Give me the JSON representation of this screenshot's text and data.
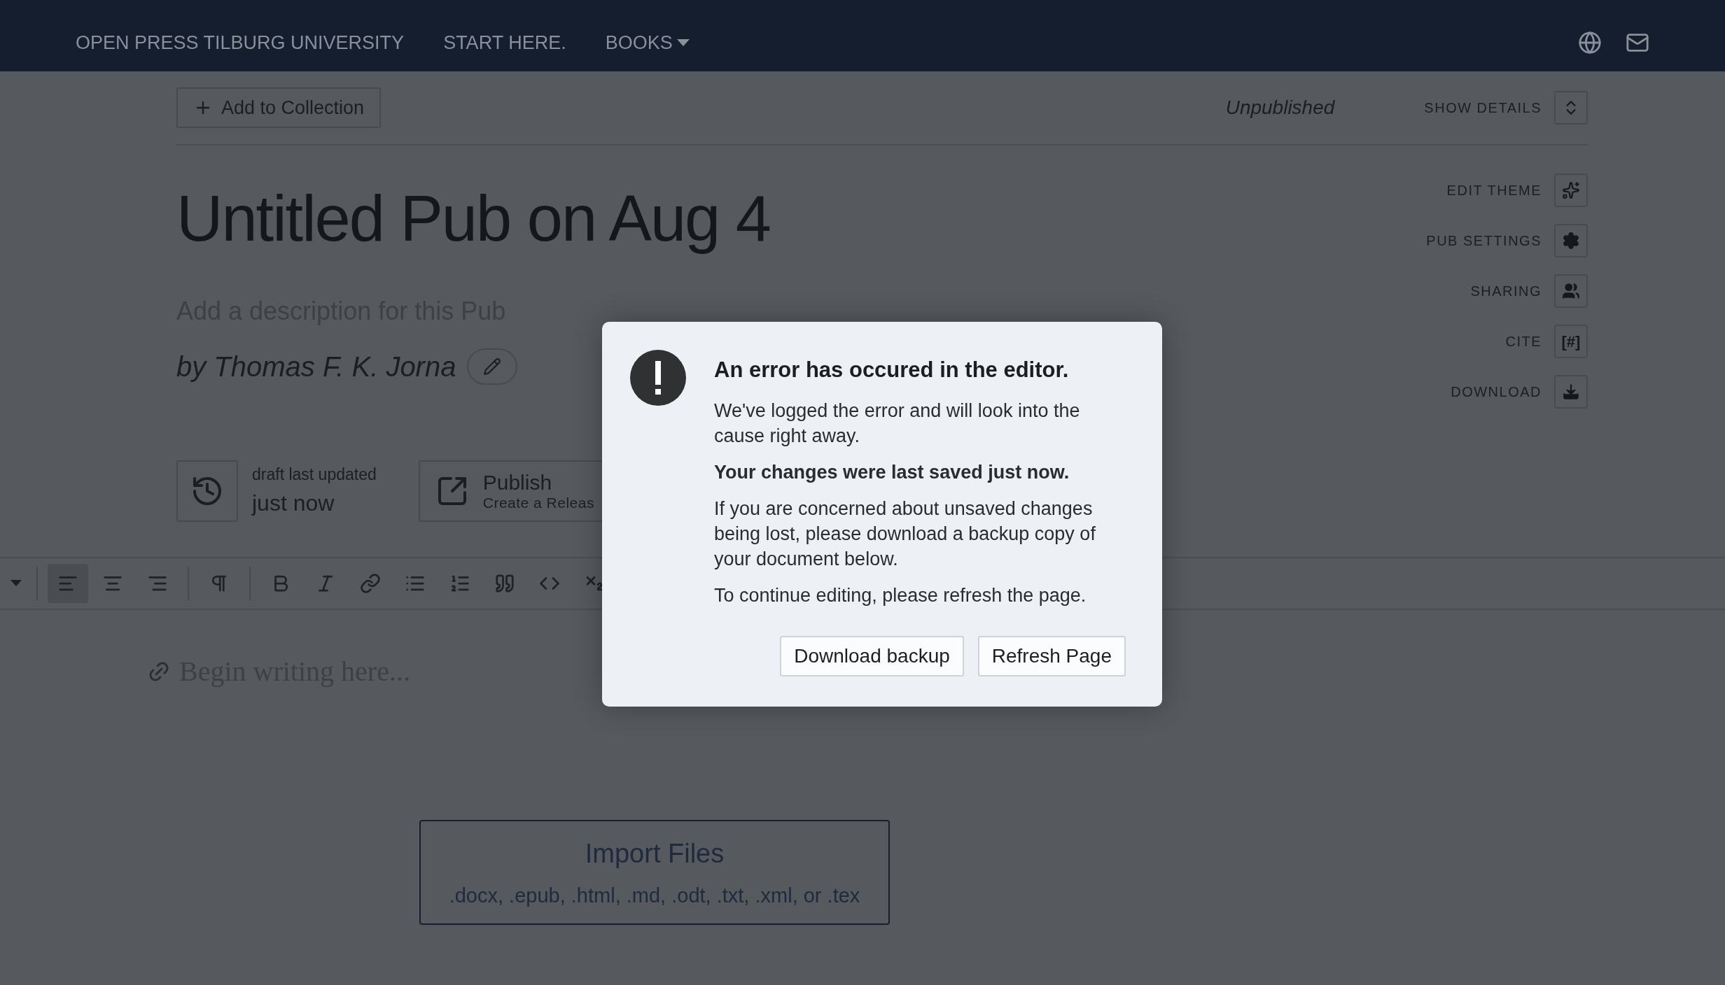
{
  "nav": {
    "items": [
      {
        "label": "OPEN PRESS TILBURG UNIVERSITY",
        "dropdown": false
      },
      {
        "label": "START HERE.",
        "dropdown": false
      },
      {
        "label": "BOOKS",
        "dropdown": true
      }
    ]
  },
  "header": {
    "collection_button": "Add to Collection",
    "status": "Unpublished",
    "details_button": "SHOW DETAILS"
  },
  "pub": {
    "title": "Untitled Pub on Aug 4",
    "description_placeholder": "Add a description for this Pub",
    "byline": "by Thomas F. K. Jorna"
  },
  "side_actions": [
    {
      "label": "EDIT THEME",
      "kind": "theme"
    },
    {
      "label": "PUB SETTINGS",
      "kind": "settings"
    },
    {
      "label": "SHARING",
      "kind": "sharing"
    },
    {
      "label": "CITE",
      "kind": "cite",
      "icon_text": "[#]"
    },
    {
      "label": "DOWNLOAD",
      "kind": "download"
    }
  ],
  "draft": {
    "caption": "draft last updated",
    "time": "just now"
  },
  "publish": {
    "title": "Publish",
    "subtitle": "Create a Releas"
  },
  "toolbar": [
    {
      "kind": "menu",
      "selected": false
    },
    {
      "kind": "align-left",
      "selected": true
    },
    {
      "kind": "align-center",
      "selected": false
    },
    {
      "kind": "align-right",
      "selected": false
    },
    {
      "kind": "paragraph",
      "selected": false
    },
    {
      "kind": "bold",
      "selected": false
    },
    {
      "kind": "italic",
      "selected": false
    },
    {
      "kind": "link",
      "selected": false
    },
    {
      "kind": "bullets",
      "selected": false
    },
    {
      "kind": "numbers",
      "selected": false
    },
    {
      "kind": "quote",
      "selected": false
    },
    {
      "kind": "code",
      "selected": false
    },
    {
      "kind": "subscript",
      "selected": false
    }
  ],
  "editor": {
    "placeholder": "Begin writing here..."
  },
  "import": {
    "title": "Import Files",
    "formats": ".docx, .epub, .html, .md, .odt, .txt, .xml, or .tex"
  },
  "dialog": {
    "title": "An error has occured in the editor.",
    "paragraphs": [
      {
        "text": "We've logged the error and will look into the cause right away.",
        "bold": false
      },
      {
        "text": "Your changes were last saved just now.",
        "bold": true
      },
      {
        "text": "If you are concerned about unsaved changes being lost, please download a backup copy of your document below.",
        "bold": false
      },
      {
        "text": "To continue editing, please refresh the page.",
        "bold": false
      }
    ],
    "buttons": [
      "Download backup",
      "Refresh Page"
    ]
  }
}
